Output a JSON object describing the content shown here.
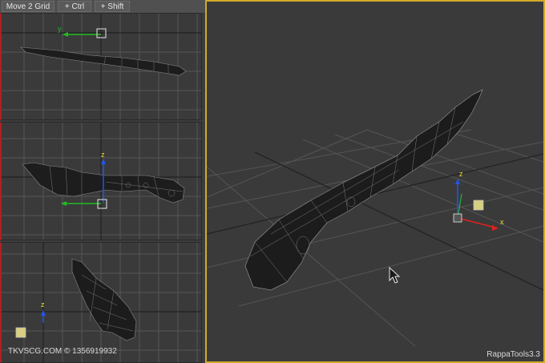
{
  "toolbar": {
    "move_grid": "Move 2 Grid",
    "ctrl": "+ Ctrl",
    "shift": "+ Shift"
  },
  "viewports": {
    "top": {
      "name": "viewport-top"
    },
    "front": {
      "name": "viewport-front",
      "axis_z": "z"
    },
    "left": {
      "name": "viewport-left",
      "axis_z": "z"
    },
    "perspective": {
      "axis_z": "z",
      "axis_x": "x"
    }
  },
  "watermark": "TKVSCG.COM © 1356919932",
  "plugin_label": "RappaTools3.3",
  "colors": {
    "active_border": "#d1a92a",
    "grid_line": "#555555",
    "axis_x": "#e02020",
    "axis_y": "#22bb22",
    "axis_z": "#2255ee",
    "gizmo_yellow": "#e8e030"
  }
}
